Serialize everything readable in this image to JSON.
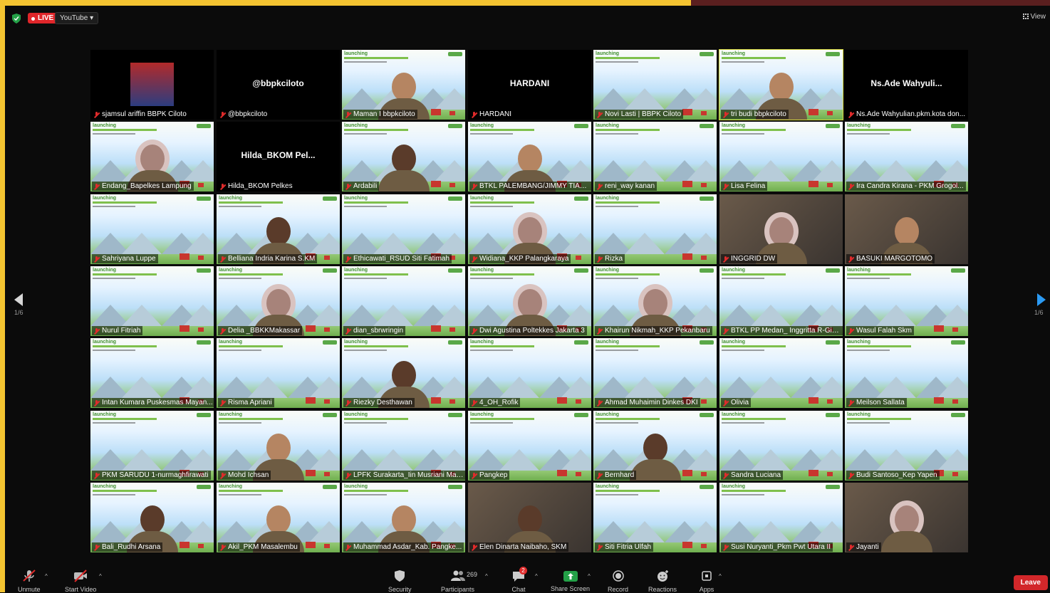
{
  "header": {
    "live_label": "LIVE",
    "stream_target": "YouTube ▾",
    "view_label": "View"
  },
  "pagination": {
    "left": "1/6",
    "right": "1/6"
  },
  "participants": [
    {
      "name": "sjamsul ariffin BBPK Ciloto",
      "bg": "photo"
    },
    {
      "name": "@bbpkciloto",
      "bg": "nameonly",
      "display": "@bbpkciloto"
    },
    {
      "name": "Maman I bbpkciloto",
      "bg": "slide",
      "person": true
    },
    {
      "name": "HARDANI",
      "bg": "nameonly",
      "display": "HARDANI"
    },
    {
      "name": "Novi Lasti | BBPK Ciloto",
      "bg": "slide"
    },
    {
      "name": "tri budi bbpkciloto",
      "bg": "slide",
      "person": true,
      "active": true
    },
    {
      "name": "Ns.Ade Wahyulian.pkm.kota don...",
      "bg": "nameonly",
      "display": "Ns.Ade  Wahyuli..."
    },
    {
      "name": "Endang_Bapelkes Lampung",
      "bg": "slide",
      "person": true,
      "hijab": true
    },
    {
      "name": "Hilda_BKOM Pelkes",
      "bg": "nameonly",
      "display": "Hilda_BKOM  Pel..."
    },
    {
      "name": "Ardabili",
      "bg": "slide",
      "person": true,
      "dark": true
    },
    {
      "name": "BTKL PALEMBANG/JIMMY TIARLI...",
      "bg": "slide",
      "person": true
    },
    {
      "name": "reni_way kanan",
      "bg": "slide"
    },
    {
      "name": "Lisa Felina",
      "bg": "slide"
    },
    {
      "name": "Ira Candra Kirana - PKM Grogol...",
      "bg": "slide"
    },
    {
      "name": "Sahriyana Luppe",
      "bg": "slide"
    },
    {
      "name": "Belliana Indria Karina S.KM",
      "bg": "slide",
      "person": true,
      "dark": true
    },
    {
      "name": "Ethicawati_RSUD Siti Fatimah",
      "bg": "slide"
    },
    {
      "name": "Widiana_KKP Palangkaraya",
      "bg": "slide",
      "person": true,
      "hijab": true
    },
    {
      "name": "Rizka",
      "bg": "slide"
    },
    {
      "name": "INGGRID DW",
      "bg": "real",
      "person": true,
      "hijab": true
    },
    {
      "name": "BASUKI MARGOTOMO",
      "bg": "real",
      "person": true
    },
    {
      "name": "Nurul Fitriah",
      "bg": "slide"
    },
    {
      "name": "Delia _BBKKMakassar",
      "bg": "slide",
      "person": true,
      "hijab": true
    },
    {
      "name": "dian_sbrwringin",
      "bg": "slide"
    },
    {
      "name": "Dwi Agustina Poltekkes Jakarta 3",
      "bg": "slide",
      "person": true,
      "hijab": true
    },
    {
      "name": "Khairun Nikmah_KKP Pekanbaru",
      "bg": "slide",
      "person": true,
      "hijab": true
    },
    {
      "name": "BTKL PP Medan_ Inggritta R-Ginti...",
      "bg": "slide"
    },
    {
      "name": "Wasul Falah Skm",
      "bg": "slide"
    },
    {
      "name": "Intan Kumara Puskesmas Mayan...",
      "bg": "slide"
    },
    {
      "name": "Risma Apriani",
      "bg": "slide"
    },
    {
      "name": "Riezky Desthawan",
      "bg": "slide",
      "person": true,
      "dark": true
    },
    {
      "name": "4_OH_Rofik",
      "bg": "slide"
    },
    {
      "name": "Ahmad Muhaimin Dinkes DKI",
      "bg": "slide"
    },
    {
      "name": "Olivia",
      "bg": "slide"
    },
    {
      "name": "Meilson Sallata",
      "bg": "slide"
    },
    {
      "name": "PKM SARUDU 1-nurmaghfirawati",
      "bg": "slide"
    },
    {
      "name": "Mohd Ichsan",
      "bg": "slide",
      "person": true
    },
    {
      "name": "LPFK Surakarta_Iin Musriani Maft...",
      "bg": "slide"
    },
    {
      "name": "Pangkep",
      "bg": "slide"
    },
    {
      "name": "Bernhard",
      "bg": "slide",
      "person": true,
      "dark": true
    },
    {
      "name": "Sandra Luciana",
      "bg": "slide"
    },
    {
      "name": "Budi Santoso_Kep Yapen",
      "bg": "slide"
    },
    {
      "name": "Bali_Rudhi Arsana",
      "bg": "slide",
      "person": true,
      "dark": true
    },
    {
      "name": "Akil_PKM Masalembu",
      "bg": "slide",
      "person": true
    },
    {
      "name": "Muhammad Asdar_Kab. Pangke...",
      "bg": "slide",
      "person": true
    },
    {
      "name": "Elen Dinarta Naibaho, SKM",
      "bg": "real",
      "person": true,
      "dark": true
    },
    {
      "name": "Siti Fitria Ulfah",
      "bg": "slide"
    },
    {
      "name": "Susi Nuryanti_Pkm Pwt Utara II",
      "bg": "slide"
    },
    {
      "name": "Jayanti",
      "bg": "real",
      "person": true,
      "hijab": true
    }
  ],
  "slide_text": {
    "title": "launching"
  },
  "toolbar": {
    "unmute": "Unmute",
    "start_video": "Start Video",
    "security": "Security",
    "participants": "Participants",
    "participants_count": "269",
    "chat": "Chat",
    "chat_badge": "2",
    "share_screen": "Share Screen",
    "record": "Record",
    "reactions": "Reactions",
    "apps": "Apps",
    "leave": "Leave"
  },
  "colors": {
    "frame": "#f4c431",
    "leave": "#d2272a",
    "live": "#e0262a",
    "share": "#24a148",
    "active_speaker": "#d4d83a"
  }
}
